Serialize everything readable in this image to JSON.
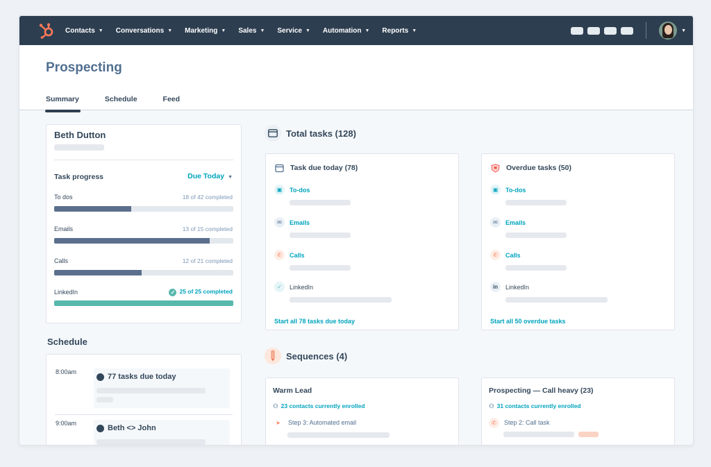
{
  "nav": {
    "items": [
      "Contacts",
      "Conversations",
      "Marketing",
      "Sales",
      "Service",
      "Automation",
      "Reports"
    ]
  },
  "page": {
    "title": "Prospecting",
    "tabs": [
      "Summary",
      "Schedule",
      "Feed"
    ]
  },
  "profile": {
    "name": "Beth Dutton",
    "task_progress_label": "Task progress",
    "due_filter": "Due Today",
    "rows": [
      {
        "label": "To dos",
        "count": "18 of 42 completed",
        "progress": 0.43
      },
      {
        "label": "Emails",
        "count": "13 of 15 completed",
        "progress": 0.87
      },
      {
        "label": "Calls",
        "count": "12 of 21 completed",
        "progress": 0.49
      },
      {
        "label": "LinkedIn",
        "count": "25 of 25 completed",
        "progress": 1.0
      }
    ]
  },
  "schedule": {
    "title": "Schedule",
    "entries": [
      {
        "time": "8:00am",
        "label": "77 tasks due today"
      },
      {
        "time": "9:00am",
        "label": "Beth <> John"
      }
    ]
  },
  "total_tasks": {
    "title": "Total tasks (128)",
    "due_today": {
      "title": "Task due today (78)",
      "items": [
        "To-dos",
        "Emails",
        "Calls",
        "LinkedIn"
      ],
      "link": "Start all 78 tasks due today"
    },
    "overdue": {
      "title": "Overdue tasks (50)",
      "items": [
        "To-dos",
        "Emails",
        "Calls",
        "LinkedIn"
      ],
      "link": "Start all 50 overdue tasks"
    }
  },
  "sequences": {
    "title": "Sequences (4)",
    "cards": [
      {
        "title": "Warm Lead",
        "enrolled": "23 contacts currently enrolled",
        "step": "Step 3: Automated email"
      },
      {
        "title": "Prospecting — Call heavy (23)",
        "enrolled": "31 contacts currently enrolled",
        "step": "Step 2: Call task"
      }
    ]
  },
  "colors": {
    "nav_bg": "#2d3e50",
    "accent": "#00a4bd",
    "brand_orange": "#ff7a59",
    "progress_fill": "#5b6f8c",
    "progress_complete": "#58b8ac"
  }
}
